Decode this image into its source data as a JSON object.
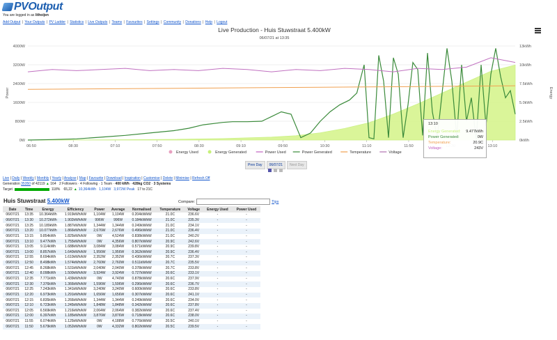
{
  "app": {
    "logo_text": "PVOutput"
  },
  "login": {
    "prefix": "You are logged in as",
    "user": "lithoijen"
  },
  "topnav": [
    "Add Output",
    "Your Outputs",
    "PV Ladder",
    "Statistics",
    "Live Outputs",
    "Teams",
    "Favourites",
    "Settings",
    "Community",
    "Donations",
    "Help",
    "Logout"
  ],
  "chart": {
    "title": "Live Production - Huis Stuwstraat 5.400kW",
    "subtitle": "06/07/21 at 13:35",
    "y_left_label": "Power",
    "y_right_label": "Energy",
    "menu_icon": "hamburger-menu-icon"
  },
  "chart_data": {
    "type": "line",
    "x_ticks": [
      "06:50",
      "08:30",
      "07:10",
      "07:50",
      "08:30",
      "09:10",
      "09:50",
      "10:30",
      "11:10",
      "11:50",
      "12:30",
      "13:10"
    ],
    "y_left_ticks": [
      "0W",
      "800W",
      "1600W",
      "2400W",
      "3200W",
      "4000W"
    ],
    "y_right_ticks": [
      "0kWh",
      "2.5kWh",
      "5.0kWh",
      "7.5kWh",
      "10kWh",
      "13kWh"
    ],
    "ylim_left": [
      0,
      4000
    ],
    "ylim_right": [
      0,
      13
    ],
    "legend_position": "bottom",
    "legend": [
      {
        "name": "Energy Used",
        "color": "#e8a0c0",
        "icon": "circle"
      },
      {
        "name": "Energy Generated",
        "color": "#c7f07a",
        "icon": "circle"
      },
      {
        "name": "Power Used",
        "color": "#c060c0",
        "icon": "line"
      },
      {
        "name": "Power Generated",
        "color": "#3a8a3a",
        "icon": "line"
      },
      {
        "name": "Temperature",
        "color": "#f0a050",
        "icon": "line"
      },
      {
        "name": "Voltage",
        "color": "#b070b0",
        "icon": "line"
      }
    ],
    "series": [
      {
        "name": "Energy Generated",
        "unit": "kWh",
        "axis": "right",
        "x": [
          0,
          0.1,
          0.2,
          0.3,
          0.4,
          0.5,
          0.55,
          0.6,
          0.65,
          0.7,
          0.75,
          0.8,
          0.85,
          0.9,
          0.95,
          1.0
        ],
        "values": [
          0,
          0.02,
          0.05,
          0.1,
          0.2,
          0.4,
          0.6,
          1.0,
          1.6,
          2.4,
          3.6,
          5.0,
          6.5,
          8.0,
          9.5,
          10.36
        ]
      },
      {
        "name": "Power Generated",
        "unit": "W",
        "axis": "left",
        "x": [
          0,
          0.05,
          0.1,
          0.15,
          0.2,
          0.25,
          0.3,
          0.33,
          0.36,
          0.4,
          0.42,
          0.45,
          0.48,
          0.5,
          0.52,
          0.54,
          0.56,
          0.58,
          0.6,
          0.62,
          0.64,
          0.66,
          0.675,
          0.69,
          0.7,
          0.71,
          0.72,
          0.73,
          0.74,
          0.75,
          0.76,
          0.77,
          0.78,
          0.79,
          0.8,
          0.81,
          0.82,
          0.83,
          0.84,
          0.85,
          0.86,
          0.87,
          0.88,
          0.89,
          0.9,
          0.91,
          0.92,
          0.93,
          0.94,
          0.95,
          0.96,
          0.97,
          0.98,
          0.99,
          1.0
        ],
        "values": [
          0,
          20,
          50,
          120,
          200,
          300,
          400,
          500,
          650,
          750,
          780,
          780,
          800,
          1000,
          1200,
          1100,
          100,
          300,
          800,
          1200,
          1500,
          1700,
          2000,
          3200,
          100,
          50,
          3600,
          2500,
          100,
          3500,
          2800,
          100,
          1500,
          3300,
          3000,
          200,
          3700,
          1200,
          100,
          2000,
          3900,
          2500,
          100,
          3200,
          800,
          1800,
          0,
          3200,
          600,
          2800,
          3900,
          2700,
          1800,
          2100,
          1100
        ]
      },
      {
        "name": "Power Used",
        "unit": "W",
        "axis": "left",
        "x": [
          0,
          0.05,
          0.1,
          0.15,
          0.2,
          0.25,
          0.3,
          0.35,
          0.4,
          0.45,
          0.5,
          0.55,
          0.6,
          0.65,
          0.7,
          0.75,
          0.8,
          0.85,
          0.9,
          0.95,
          1.0
        ],
        "values": [
          2900,
          3000,
          2950,
          3000,
          3050,
          2950,
          3000,
          2950,
          3050,
          3000,
          2900,
          3000,
          2950,
          3050,
          3000,
          2900,
          3050,
          3000,
          3100,
          3500,
          3300
        ]
      },
      {
        "name": "Temperature",
        "unit": "C",
        "axis": "right",
        "x": [
          0,
          0.2,
          0.4,
          0.6,
          0.8,
          1.0
        ],
        "values": [
          7.0,
          7.1,
          7.2,
          7.3,
          7.4,
          7.5
        ]
      }
    ]
  },
  "tooltip": {
    "time": "13:10",
    "rows": [
      {
        "label": "Energy Generated:",
        "value": "9.477kWh",
        "color": "#c7f07a"
      },
      {
        "label": "Power Generated:",
        "value": "0W",
        "color": "#3a8a3a"
      },
      {
        "label": "Temperature:",
        "value": "20.9C",
        "color": "#f0a050"
      },
      {
        "label": "Voltage:",
        "value": "243V",
        "color": "#c060c0"
      }
    ]
  },
  "zoom_buttons": {
    "prev": "Prev Day",
    "date": "06/07/21",
    "next": "Next Day"
  },
  "subnav": [
    "Live",
    "Daily",
    "Weekly",
    "Monthly",
    "Yearly",
    "Analyse",
    "Map",
    "Favourite",
    "Download",
    "Inspiration",
    "Customise",
    "Delete",
    "Minimise",
    "Refresh Off"
  ],
  "generation": {
    "label": "Generation",
    "link_value": "35350",
    "rest": "of 42119",
    "rank_change": "164",
    "followers": "2 Followers",
    "following": "4 Following",
    "team": "1 Team",
    "kwh": "400 kWh",
    "co2": "428kg CO2",
    "systems": "3 Systems"
  },
  "target": {
    "label": "Target",
    "percent": "118%",
    "money": "€6,22",
    "energy": "10,364kWh",
    "power": "1,104W",
    "peak": "3,972W Peak",
    "temp": "17 to 21C",
    "fill_fraction": 1.0
  },
  "system": {
    "name": "Huis Stuwstraat",
    "size": "5.400kW"
  },
  "compare": {
    "label": "Compare:",
    "tips": "Tips"
  },
  "table": {
    "headers": [
      "Date",
      "Time",
      "Energy",
      "Efficiency",
      "Power",
      "Average",
      "Normalised",
      "Temperature",
      "Voltage",
      "Energy Used",
      "Power Used"
    ],
    "rows": [
      [
        "06/07/21",
        "13:35",
        "10.364kWh",
        "1.919kWh/kW",
        "1,104W",
        "1,104W",
        "0.204kW/kW",
        "21.0C",
        "236.6V",
        "-",
        "-"
      ],
      [
        "06/07/21",
        "13:30",
        "10.272kWh",
        "1.902kWh/kW",
        "996W",
        "996W",
        "0.184kW/kW",
        "21.0C",
        "235.3V",
        "-",
        "-"
      ],
      [
        "06/07/21",
        "13:25",
        "10.189kWh",
        "1.887kWh/kW",
        "1,344W",
        "1,344W",
        "0.249kW/kW",
        "21.0C",
        "234.1V",
        "-",
        "-"
      ],
      [
        "06/07/21",
        "13:20",
        "10.077kWh",
        "1.866kWh/kW",
        "2,676W",
        "2,676W",
        "0.496kW/kW",
        "21.0C",
        "236.4V",
        "-",
        "-"
      ],
      [
        "06/07/21",
        "13:15",
        "9.854kWh",
        "1.825kWh/kW",
        "0W",
        "4,524W",
        "0.838kW/kW",
        "21.0C",
        "240.2V",
        "-",
        "-"
      ],
      [
        "06/07/21",
        "13:10",
        "9.477kWh",
        "1.755kWh/kW",
        "0W",
        "4,356W",
        "0.807kW/kW",
        "20.9C",
        "242.6V",
        "-",
        "-"
      ],
      [
        "06/07/21",
        "13:05",
        "9.114kWh",
        "1.688kWh/kW",
        "3,084W",
        "3,084W",
        "0.571kW/kW",
        "20.9C",
        "239.8V",
        "-",
        "-"
      ],
      [
        "06/07/21",
        "13:00",
        "8.857kWh",
        "1.640kWh/kW",
        "1,956W",
        "1,956W",
        "0.362kW/kW",
        "20.9C",
        "236.4V",
        "-",
        "-"
      ],
      [
        "06/07/21",
        "12:55",
        "8.694kWh",
        "1.610kWh/kW",
        "2,352W",
        "2,352W",
        "0.436kW/kW",
        "20.7C",
        "237.3V",
        "-",
        "-"
      ],
      [
        "06/07/21",
        "12:50",
        "8.498kWh",
        "1.574kWh/kW",
        "2,760W",
        "2,760W",
        "0.511kW/kW",
        "20.7C",
        "235.5V",
        "-",
        "-"
      ],
      [
        "06/07/21",
        "12:45",
        "8.268kWh",
        "1.531kWh/kW",
        "2,040W",
        "2,040W",
        "0.378kW/kW",
        "20.7C",
        "233.8V",
        "-",
        "-"
      ],
      [
        "06/07/21",
        "12:40",
        "8.098kWh",
        "1.500kWh/kW",
        "3,924W",
        "3,924W",
        "0.727kW/kW",
        "20.6C",
        "233.1V",
        "-",
        "-"
      ],
      [
        "06/07/21",
        "12:35",
        "7.771kWh",
        "1.439kWh/kW",
        "0W",
        "4,740W",
        "0.878kW/kW",
        "20.6C",
        "237.9V",
        "-",
        "-"
      ],
      [
        "06/07/21",
        "12:30",
        "7.376kWh",
        "1.366kWh/kW",
        "1,596W",
        "1,596W",
        "0.296kW/kW",
        "20.6C",
        "236.7V",
        "-",
        "-"
      ],
      [
        "06/07/21",
        "12:25",
        "7.243kWh",
        "1.341kWh/kW",
        "3,240W",
        "3,240W",
        "0.600kW/kW",
        "20.6C",
        "233.8V",
        "-",
        "-"
      ],
      [
        "06/07/21",
        "12:20",
        "6.973kWh",
        "1.291kWh/kW",
        "1,656W",
        "1,656W",
        "0.307kW/kW",
        "20.6C",
        "241.1V",
        "-",
        "-"
      ],
      [
        "06/07/21",
        "12:15",
        "6.835kWh",
        "1.266kWh/kW",
        "1,344W",
        "1,344W",
        "0.249kW/kW",
        "20.6C",
        "234.0V",
        "-",
        "-"
      ],
      [
        "06/07/21",
        "12:10",
        "6.723kWh",
        "1.245kWh/kW",
        "1,848W",
        "1,848W",
        "0.342kW/kW",
        "20.6C",
        "237.8V",
        "-",
        "-"
      ],
      [
        "06/07/21",
        "12:05",
        "6.569kWh",
        "1.216kWh/kW",
        "2,064W",
        "2,064W",
        "0.382kW/kW",
        "20.6C",
        "237.4V",
        "-",
        "-"
      ],
      [
        "06/07/21",
        "12:00",
        "6.397kWh",
        "1.185kWh/kW",
        "3,876W",
        "3,876W",
        "0.718kW/kW",
        "20.6C",
        "238.0V",
        "-",
        "-"
      ],
      [
        "06/07/21",
        "11:55",
        "6.074kWh",
        "1.125kWh/kW",
        "0W",
        "4,188W",
        "0.776kW/kW",
        "20.5C",
        "240.1V",
        "-",
        "-"
      ],
      [
        "06/07/21",
        "11:50",
        "5.679kWh",
        "1.052kWh/kW",
        "0W",
        "4,332W",
        "0.802kW/kW",
        "20.5C",
        "239.5V",
        "-",
        "-"
      ]
    ]
  }
}
